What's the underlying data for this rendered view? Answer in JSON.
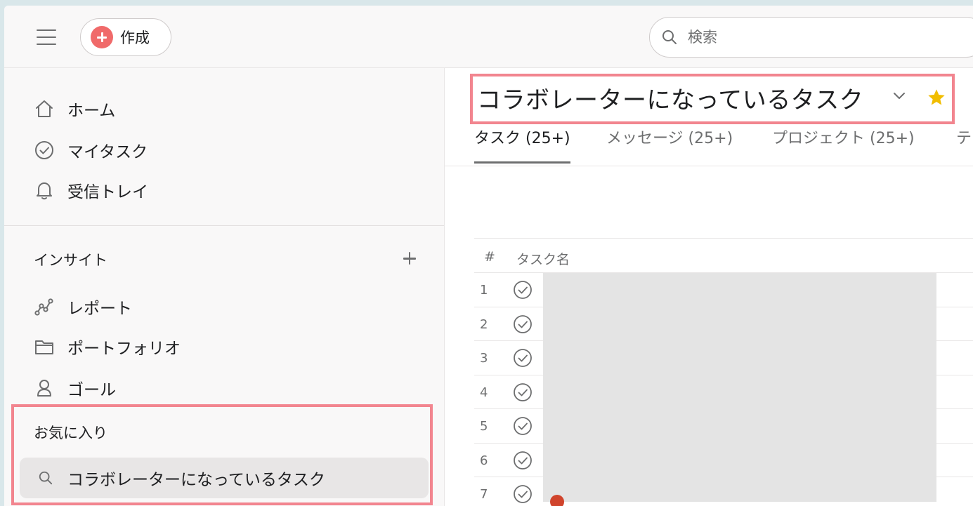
{
  "topbar": {
    "create_label": "作成",
    "search_placeholder": "検索"
  },
  "sidebar": {
    "nav": [
      {
        "label": "ホーム",
        "icon": "home-icon"
      },
      {
        "label": "マイタスク",
        "icon": "check-circle-icon"
      },
      {
        "label": "受信トレイ",
        "icon": "bell-icon"
      }
    ],
    "insights": {
      "title": "インサイト",
      "items": [
        {
          "label": "レポート",
          "icon": "report-graph-icon"
        },
        {
          "label": "ポートフォリオ",
          "icon": "folder-icon"
        },
        {
          "label": "ゴール",
          "icon": "goal-person-icon"
        }
      ]
    },
    "favorites": {
      "title": "お気に入り",
      "items": [
        {
          "label": "コラボレーターになっているタスク",
          "icon": "search-icon"
        }
      ]
    }
  },
  "main": {
    "title": "コラボレーターになっているタスク",
    "tabs": [
      {
        "label": "タスク (25+)",
        "active": true
      },
      {
        "label": "メッセージ (25+)",
        "active": false
      },
      {
        "label": "プロジェクト (25+)",
        "active": false
      },
      {
        "label": "テ",
        "active": false
      }
    ],
    "table": {
      "columns": [
        "#",
        "タスク名"
      ],
      "rows": [
        {
          "num": "1"
        },
        {
          "num": "2"
        },
        {
          "num": "3"
        },
        {
          "num": "4"
        },
        {
          "num": "5"
        },
        {
          "num": "6"
        },
        {
          "num": "7"
        }
      ]
    }
  },
  "colors": {
    "accent_create": "#f06a6a",
    "highlight_border": "#f2858f",
    "star": "#f1bd00"
  }
}
